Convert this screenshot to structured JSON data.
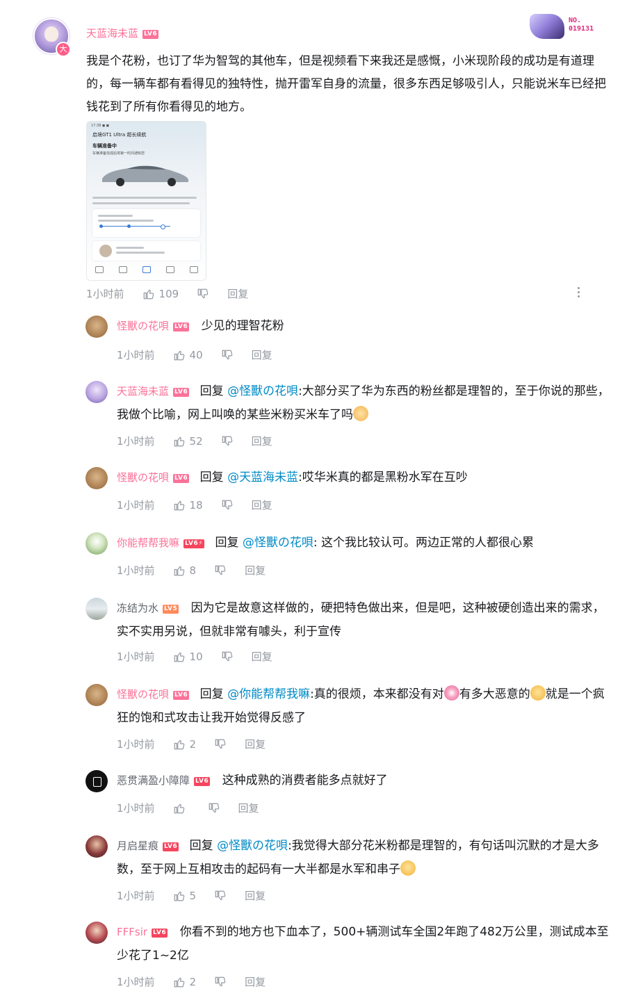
{
  "main_comment": {
    "username": "天蓝海未蓝",
    "level": "LV6",
    "avatar_badge": "大",
    "decoration_no_label": "NO.",
    "decoration_no_value": "019131",
    "text": "我是个花粉，也订了华为智驾的其他车，但是视频看下来我还是感慨，小米现阶段的成功是有道理的，每一辆车都有看得见的独特性，抛开雷军自身的流量，很多东西足够吸引人，只能说米车已经把钱花到了所有你看得见的地方。",
    "image": {
      "top_title": "启境GT1 Ultra 超长续航",
      "heading": "车辆准备中",
      "sub": "车辆准备完成后将第一时间通知您"
    },
    "time": "1小时前",
    "likes": "109",
    "reply_label": "回复"
  },
  "replies": [
    {
      "username": "怪獸の花唄",
      "level": "LV6",
      "is_reply": false,
      "reply_word": "",
      "at": "",
      "text": "少见的理智花粉",
      "time": "1小时前",
      "likes": "40",
      "reply_label": "回复"
    },
    {
      "username": "天蓝海未蓝",
      "level": "LV6",
      "is_reply": true,
      "reply_word": "回复",
      "at": "@怪獸の花唄",
      "text": ":大部分买了华为东西的粉丝都是理智的，至于你说的那些，我做个比喻，网上叫唤的某些米粉买米车了吗",
      "time": "1小时前",
      "likes": "52",
      "reply_label": "回复"
    },
    {
      "username": "怪獸の花唄",
      "level": "LV6",
      "is_reply": true,
      "reply_word": "回复",
      "at": "@天蓝海未蓝",
      "text": ":哎华米真的都是黑粉水军在互吵",
      "time": "1小时前",
      "likes": "18",
      "reply_label": "回复"
    },
    {
      "username": "你能帮帮我嘛",
      "level": "LV6⚡",
      "is_reply": true,
      "reply_word": "回复",
      "at": "@怪獸の花唄",
      "text": ": 这个我比较认可。两边正常的人都很心累",
      "time": "1小时前",
      "likes": "8",
      "reply_label": "回复"
    },
    {
      "username": "冻结为水",
      "level": "LV5",
      "is_reply": false,
      "reply_word": "",
      "at": "",
      "text": "因为它是故意这样做的，硬把特色做出来，但是吧，这种被硬创造出来的需求，实不实用另说，但就非常有噱头，利于宣传",
      "time": "1小时前",
      "likes": "10",
      "reply_label": "回复"
    },
    {
      "username": "怪獸の花唄",
      "level": "LV6",
      "is_reply": true,
      "reply_word": "回复",
      "at": "@你能帮帮我嘛",
      "text": ":真的很烦，本来都没有对",
      "text2": "有多大恶意的",
      "text3": "就是一个疯狂的饱和式攻击让我开始觉得反感了",
      "time": "1小时前",
      "likes": "2",
      "reply_label": "回复"
    },
    {
      "username": "恶贯满盈小障障",
      "level": "LV6",
      "is_reply": false,
      "reply_word": "",
      "at": "",
      "text": "这种成熟的消费者能多点就好了",
      "time": "1小时前",
      "likes": "",
      "reply_label": "回复"
    },
    {
      "username": "月启星痕",
      "level": "LV6",
      "is_reply": true,
      "reply_word": "回复",
      "at": "@怪獸の花唄",
      "text": ":我觉得大部分花米粉都是理智的，有句话叫沉默的才是大多数，至于网上互相攻击的起码有一大半都是水军和串子",
      "time": "1小时前",
      "likes": "5",
      "reply_label": "回复"
    },
    {
      "username": "FFFsir",
      "level": "LV6",
      "is_reply": false,
      "reply_word": "",
      "at": "",
      "text": "你看不到的地方也下血本了，500+辆测试车全国2年跑了482万公里，测试成本至少花了1~2亿",
      "time": "1小时前",
      "likes": "2",
      "reply_label": "回复"
    }
  ],
  "colors": {
    "username_pink": "#fb7299",
    "username_gray": "#61666d",
    "link_blue": "#008ac5",
    "meta_gray": "#9499a0"
  },
  "icons": {
    "like": "thumbs-up-icon",
    "dislike": "thumbs-down-icon",
    "more": "more-vertical-icon"
  }
}
